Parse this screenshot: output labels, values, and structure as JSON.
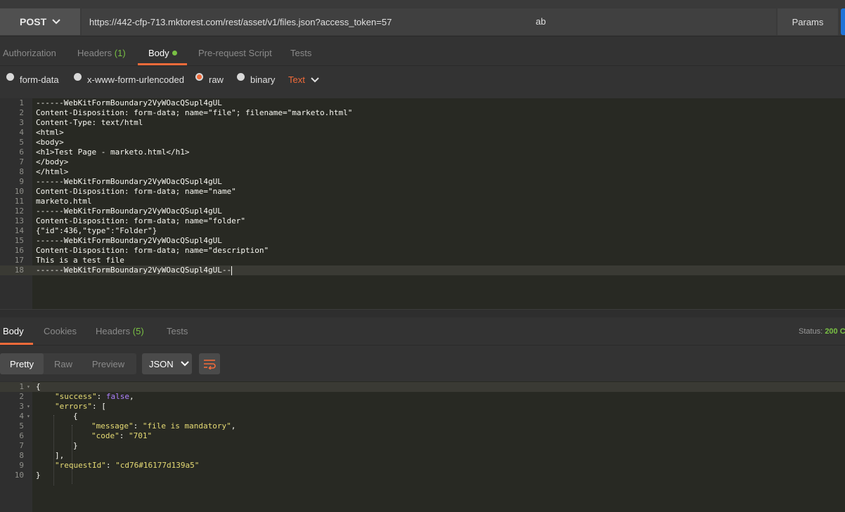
{
  "request": {
    "method": "POST",
    "url": "https://442-cfp-713.mktorest.com/rest/asset/v1/files.json?access_token=57",
    "url_tail": "ab",
    "params_label": "Params"
  },
  "request_tabs": {
    "authorization": "Authorization",
    "headers_label": "Headers",
    "headers_count": "(1)",
    "body": "Body",
    "prerequest": "Pre-request Script",
    "tests": "Tests"
  },
  "body_options": {
    "form_data": "form-data",
    "urlencoded": "x-www-form-urlencoded",
    "raw": "raw",
    "binary": "binary",
    "text_type": "Text"
  },
  "request_body": {
    "lines": [
      "------WebKitFormBoundary2VyWOacQSupl4gUL",
      "Content-Disposition: form-data; name=\"file\"; filename=\"marketo.html\"",
      "Content-Type: text/html",
      "<html>",
      "<body>",
      "<h1>Test Page - marketo.html</h1>",
      "</body>",
      "</html>",
      "------WebKitFormBoundary2VyWOacQSupl4gUL",
      "Content-Disposition: form-data; name=\"name\"",
      "marketo.html",
      "------WebKitFormBoundary2VyWOacQSupl4gUL",
      "Content-Disposition: form-data; name=\"folder\"",
      "{\"id\":436,\"type\":\"Folder\"}",
      "------WebKitFormBoundary2VyWOacQSupl4gUL",
      "Content-Disposition: form-data; name=\"description\"",
      "This is a test file",
      "------WebKitFormBoundary2VyWOacQSupl4gUL--"
    ]
  },
  "response_tabs": {
    "body": "Body",
    "cookies": "Cookies",
    "headers_label": "Headers",
    "headers_count": "(5)",
    "tests": "Tests",
    "status_label": "Status:",
    "status_value": "200 C"
  },
  "response_view": {
    "pretty": "Pretty",
    "raw": "Raw",
    "preview": "Preview",
    "format": "JSON"
  },
  "response_body": {
    "l1": "{",
    "success_key": "\"success\"",
    "success_val": "false",
    "errors_key": "\"errors\"",
    "l3_open": "[",
    "l4": "{",
    "message_key": "\"message\"",
    "message_val": "\"file is mandatory\"",
    "code_key": "\"code\"",
    "code_val": "\"701\"",
    "l7": "}",
    "l8": "],",
    "requestid_key": "\"requestId\"",
    "requestid_val": "\"cd76#16177d139a5\"",
    "l10": "}"
  },
  "colors": {
    "accent": "#f26b3a",
    "success_green": "#79c044",
    "send_blue": "#1f73d8"
  }
}
